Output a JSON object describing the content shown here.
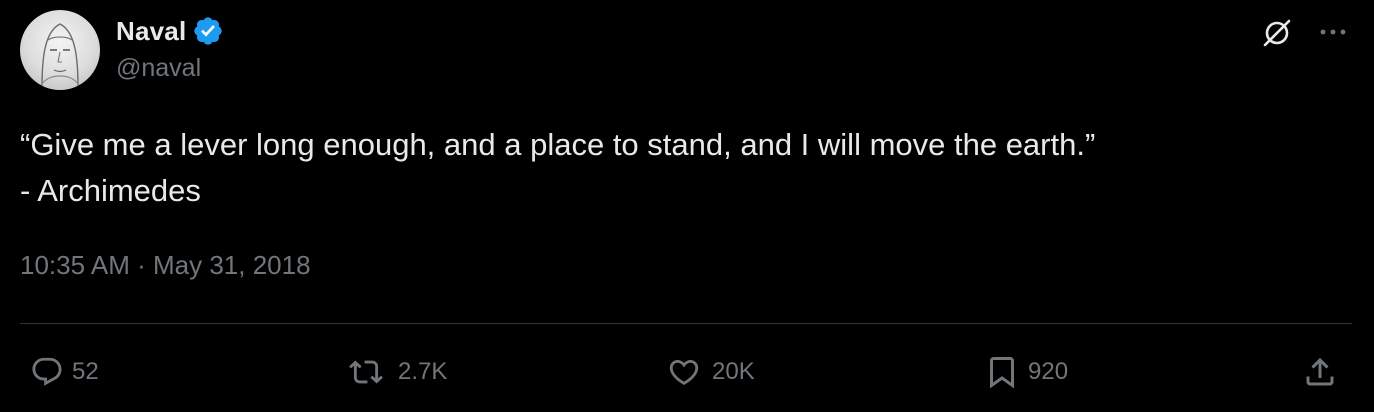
{
  "author": {
    "display_name": "Naval",
    "handle": "@naval",
    "verified": true
  },
  "tweet": {
    "text": "“Give me a lever long enough, and a place to stand, and I will move the earth.”\n- Archimedes",
    "time": "10:35 AM",
    "separator": "·",
    "date": "May 31, 2018"
  },
  "actions": {
    "replies": "52",
    "reposts": "2.7K",
    "likes": "20K",
    "bookmarks": "920"
  },
  "icons": {
    "verified": "verified-badge-icon",
    "grok": "grok-icon",
    "more": "more-icon",
    "reply": "reply-icon",
    "repost": "repost-icon",
    "like": "heart-icon",
    "bookmark": "bookmark-icon",
    "share": "share-icon"
  },
  "colors": {
    "background": "#000000",
    "text": "#e7e9ea",
    "muted": "#71767b",
    "divider": "#2f3336",
    "verified": "#1d9bf0"
  }
}
